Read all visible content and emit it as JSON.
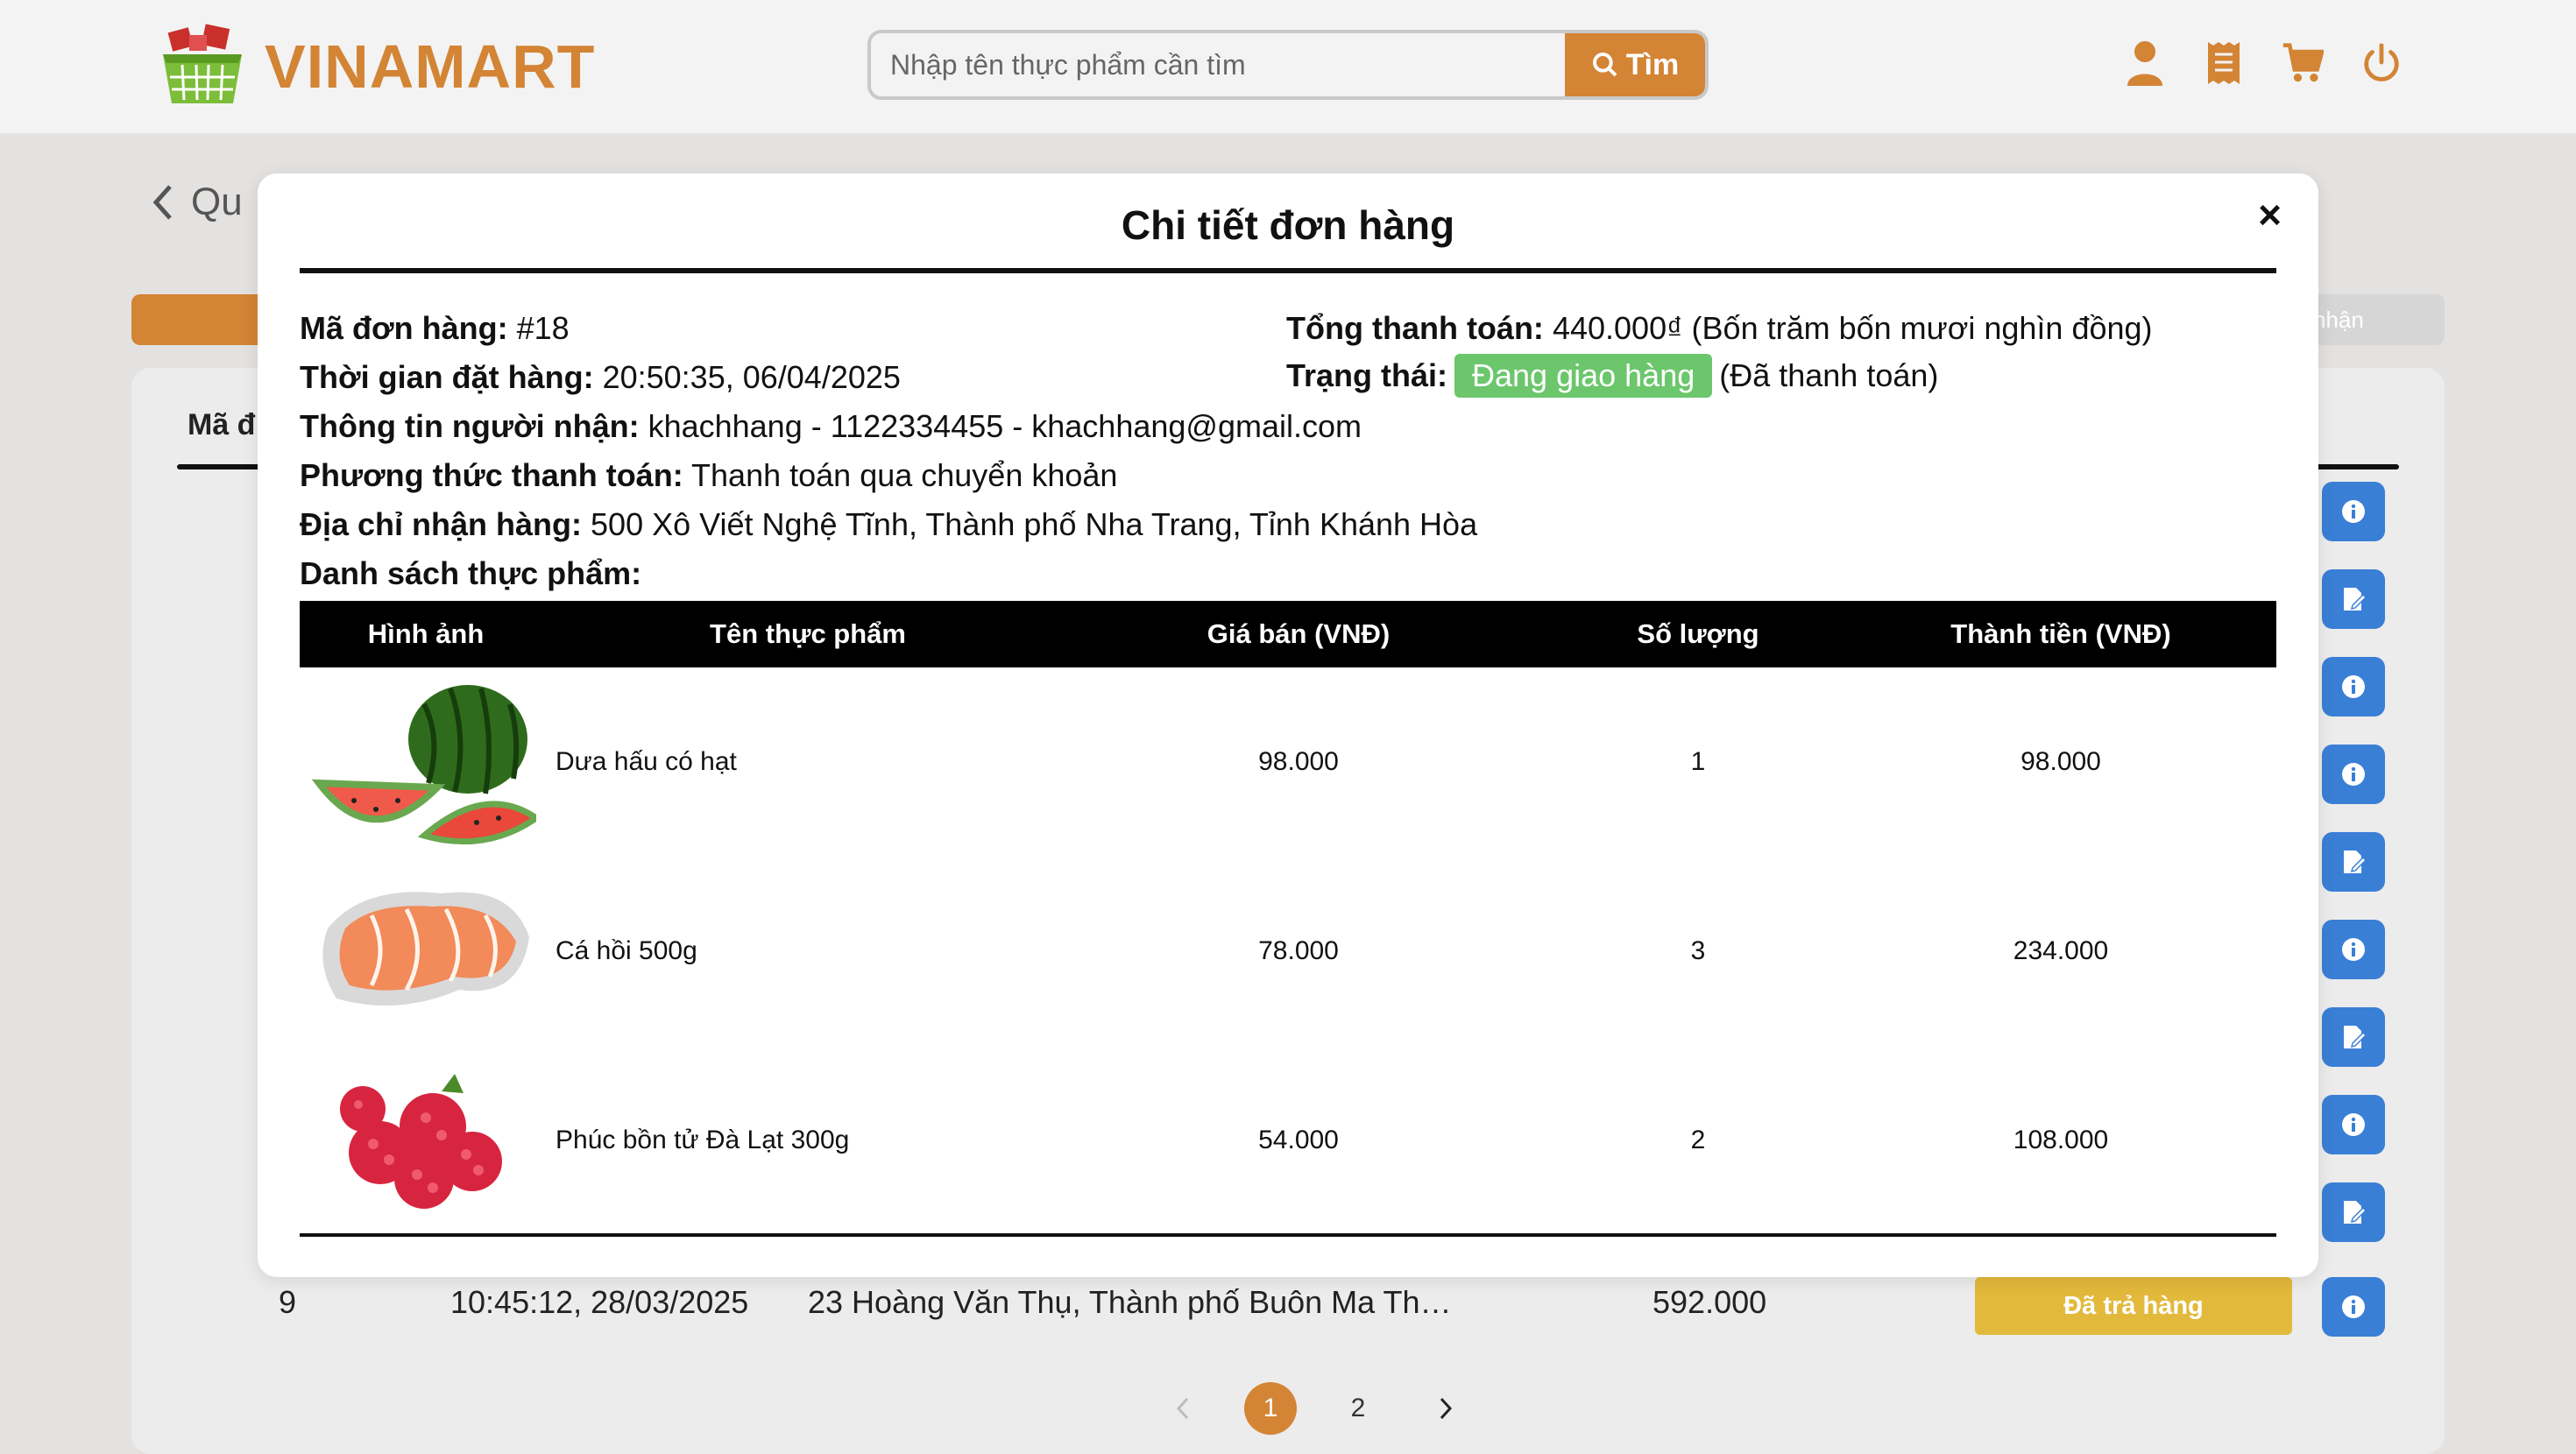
{
  "brand": {
    "name": "VINAMART"
  },
  "search": {
    "placeholder": "Nhập tên thực phẩm cần tìm",
    "button_label": "Tìm"
  },
  "header_icons": [
    "user-icon",
    "receipt-icon",
    "cart-icon",
    "power-icon"
  ],
  "background": {
    "back_label": "Qu",
    "tab_right_label": "nhận",
    "column_header": "Mã đ",
    "visible_row": {
      "id": "9",
      "time": "10:45:12, 28/03/2025",
      "address": "23 Hoàng Văn Thụ, Thành phố Buôn Ma Th…",
      "total": "592.000",
      "status": "Đã trả hàng"
    },
    "pagination": {
      "pages": [
        "1",
        "2"
      ],
      "current": "1"
    }
  },
  "modal": {
    "title": "Chi tiết đơn hàng",
    "close_label": "×",
    "order_id_label": "Mã đơn hàng:",
    "order_id": "#18",
    "order_time_label": "Thời gian đặt hàng:",
    "order_time": "20:50:35, 06/04/2025",
    "receiver_label": "Thông tin người nhận:",
    "receiver": "khachhang - 1122334455 - khachhang@gmail.com",
    "payment_label": "Phương thức thanh toán:",
    "payment": "Thanh toán qua chuyển khoản",
    "address_label": "Địa chỉ nhận hàng:",
    "address": "500 Xô Viết Nghệ Tĩnh, Thành phố Nha Trang, Tỉnh Khánh Hòa",
    "total_label": "Tổng thanh toán:",
    "total": "440.000₫ (Bốn trăm bốn mươi nghìn đồng)",
    "status_label": "Trạng thái:",
    "status": "Đang giao hàng",
    "payment_status": "(Đã thanh toán)",
    "items_label": "Danh sách thực phẩm:",
    "table": {
      "headers": [
        "Hình ảnh",
        "Tên thực phẩm",
        "Giá bán (VNĐ)",
        "Số lượng",
        "Thành tiền (VNĐ)"
      ],
      "rows": [
        {
          "image": "watermelon",
          "name": "Dưa hấu có hạt",
          "price": "98.000",
          "qty": "1",
          "subtotal": "98.000"
        },
        {
          "image": "salmon",
          "name": "Cá hồi 500g",
          "price": "78.000",
          "qty": "3",
          "subtotal": "234.000"
        },
        {
          "image": "raspberry",
          "name": "Phúc bồn tử Đà Lạt 300g",
          "price": "54.000",
          "qty": "2",
          "subtotal": "108.000"
        }
      ]
    }
  },
  "colors": {
    "brand": "#d38434",
    "status_green": "#6cc66c",
    "action_blue": "#3a7fd6",
    "returned_gold": "#e3b93c"
  }
}
